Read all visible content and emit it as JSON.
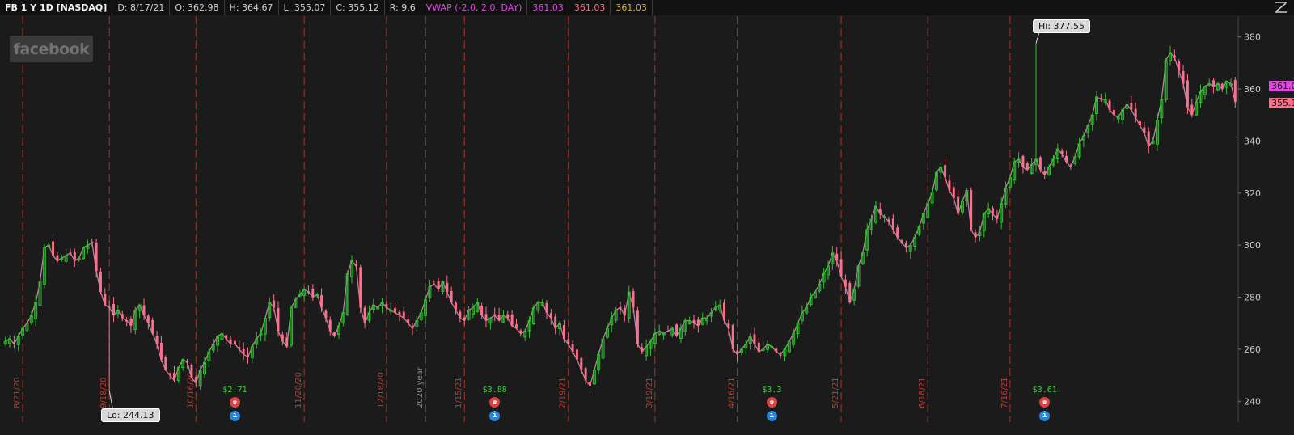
{
  "header": {
    "symbol": "FB 1 Y 1D [NASDAQ]",
    "date": "D: 8/17/21",
    "open": "O: 362.98",
    "high": "H: 364.67",
    "low": "L: 355.07",
    "close": "C: 355.12",
    "range": "R: 9.6",
    "vwap_label": "VWAP (-2.0, 2.0, DAY)",
    "vwap_values": [
      "361.03",
      "361.03",
      "361.03"
    ]
  },
  "watermark": "facebook",
  "colors": {
    "background": "#1b1b1b",
    "up_candle": "#2fbf2f",
    "down_candle": "#ff6e8a",
    "vwap_line": "#c98fb0",
    "period_line": "#c0392b",
    "year_line": "#808080",
    "vwap_tag": "#e049e0",
    "last_tag": "#ff6e8a"
  },
  "callouts": {
    "hi": "Hi: 377.55",
    "lo": "Lo: 244.13"
  },
  "price_tags": {
    "vwap": "361.0",
    "last": "355.1"
  },
  "events": [
    {
      "amount": "$2.71",
      "date_index": 53
    },
    {
      "amount": "$3.88",
      "date_index": 113
    },
    {
      "amount": "$3.3",
      "date_index": 177
    },
    {
      "amount": "$3.61",
      "date_index": 240
    }
  ],
  "chart_data": {
    "type": "candlestick",
    "title": "FB 1 Y 1D [NASDAQ]",
    "ylim": [
      232,
      388
    ],
    "y_ticks": [
      240,
      260,
      280,
      300,
      320,
      340,
      360,
      380
    ],
    "x_labels": [
      {
        "label": "8/21/20",
        "index": 4
      },
      {
        "label": "9/18/20",
        "index": 24
      },
      {
        "label": "10/16/20",
        "index": 44
      },
      {
        "label": "11/20/20",
        "index": 69
      },
      {
        "label": "12/18/20",
        "index": 88
      },
      {
        "label": "2020 year",
        "index": 97
      },
      {
        "label": "1/15/21",
        "index": 106
      },
      {
        "label": "2/19/21",
        "index": 130
      },
      {
        "label": "3/19/21",
        "index": 150
      },
      {
        "label": "4/16/21",
        "index": 169
      },
      {
        "label": "5/21/21",
        "index": 193
      },
      {
        "label": "6/18/21",
        "index": 213
      },
      {
        "label": "7/16/21",
        "index": 232
      }
    ],
    "period_lines": [
      4,
      24,
      44,
      69,
      88,
      106,
      130,
      150,
      169,
      193,
      213,
      232
    ],
    "year_line": 97,
    "last_value": 355.12,
    "vwap_value": 361.03,
    "hi": {
      "value": 377.55,
      "index": 238
    },
    "lo": {
      "value": 244.13,
      "index": 24
    },
    "closes": [
      263,
      264,
      262,
      265,
      268,
      270,
      273,
      278,
      286,
      299,
      300,
      296,
      294,
      295,
      296,
      297,
      294,
      295,
      299,
      300,
      301,
      290,
      282,
      277,
      276,
      273,
      275,
      272,
      271,
      269,
      275,
      277,
      273,
      270,
      266,
      262,
      256,
      252,
      250,
      248,
      253,
      256,
      255,
      249,
      247,
      252,
      255,
      259,
      262,
      265,
      266,
      264,
      262,
      262,
      260,
      258,
      257,
      261,
      264,
      266,
      272,
      278,
      276,
      267,
      263,
      261,
      276,
      279,
      281,
      283,
      282,
      280,
      281,
      276,
      272,
      267,
      265,
      269,
      274,
      289,
      294,
      292,
      276,
      270,
      274,
      277,
      276,
      278,
      276,
      275,
      274,
      273,
      272,
      270,
      268,
      271,
      274,
      279,
      284,
      285,
      283,
      286,
      282,
      278,
      275,
      272,
      271,
      275,
      276,
      278,
      273,
      271,
      272,
      273,
      271,
      273,
      272,
      269,
      268,
      266,
      267,
      271,
      276,
      278,
      278,
      274,
      272,
      268,
      270,
      264,
      262,
      259,
      256,
      252,
      248,
      246,
      252,
      258,
      264,
      268,
      272,
      275,
      276,
      273,
      282,
      276,
      262,
      259,
      261,
      263,
      266,
      267,
      266,
      267,
      268,
      265,
      268,
      271,
      271,
      270,
      269,
      272,
      272,
      274,
      276,
      277,
      271,
      268,
      260,
      258,
      260,
      262,
      265,
      262,
      259,
      260,
      262,
      261,
      259,
      258,
      260,
      263,
      266,
      270,
      274,
      276,
      280,
      282,
      285,
      289,
      292,
      297,
      294,
      288,
      284,
      278,
      283,
      292,
      297,
      306,
      310,
      315,
      312,
      311,
      309,
      306,
      303,
      301,
      299,
      300,
      303,
      307,
      312,
      316,
      320,
      328,
      330,
      326,
      321,
      318,
      312,
      317,
      321,
      306,
      303,
      305,
      312,
      314,
      312,
      310,
      316,
      322,
      326,
      332,
      333,
      330,
      329,
      331,
      333,
      329,
      327,
      330,
      333,
      337,
      335,
      332,
      330,
      334,
      339,
      342,
      346,
      350,
      357,
      356,
      356,
      352,
      350,
      349,
      352,
      354,
      352,
      349,
      346,
      343,
      338,
      340,
      348,
      356,
      371,
      374,
      372,
      367,
      362,
      353,
      350,
      355,
      359,
      361,
      362,
      361,
      362,
      360,
      363,
      362,
      355
    ]
  }
}
